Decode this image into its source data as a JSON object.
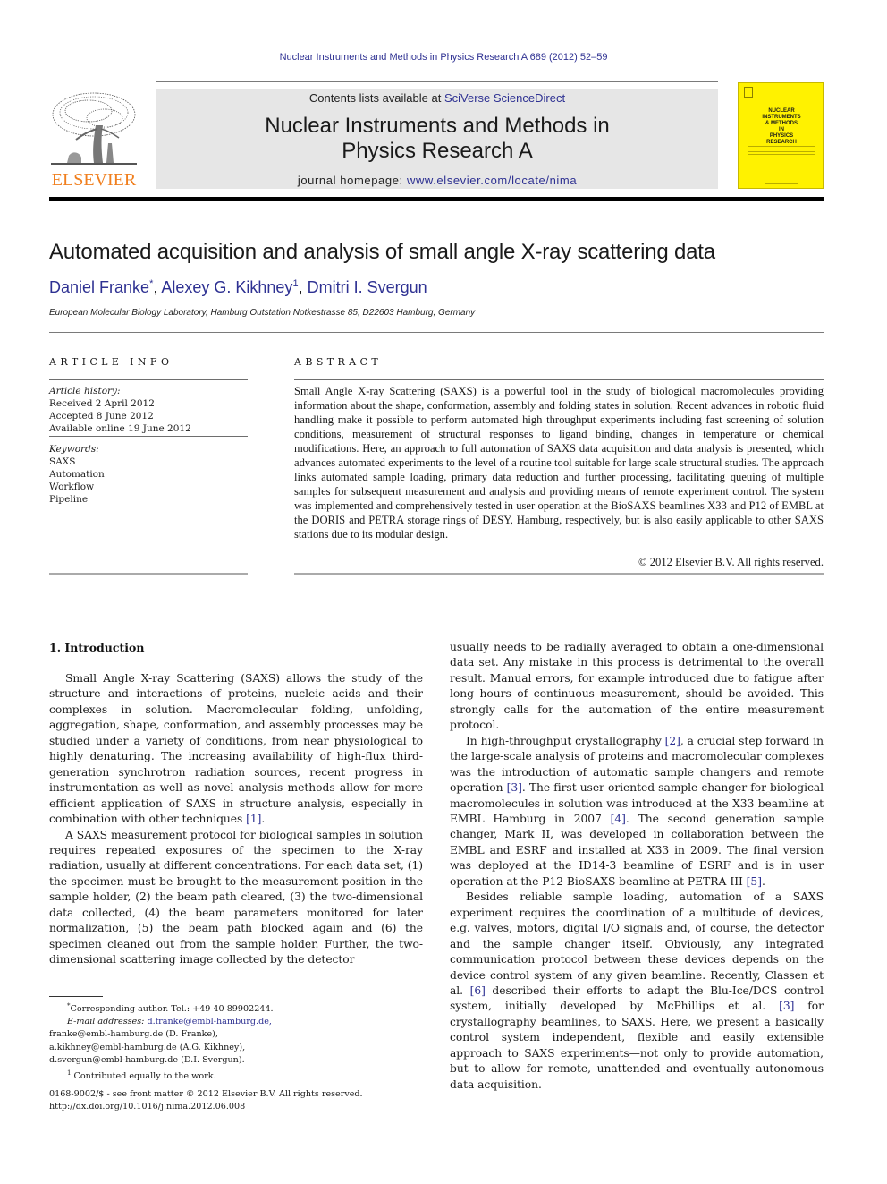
{
  "header": {
    "citation": "Nuclear Instruments and Methods in Physics Research A 689 (2012) 52–59",
    "contents_prefix": "Contents lists available at ",
    "contents_link": "SciVerse ScienceDirect",
    "journal_title_line1": "Nuclear Instruments and Methods in",
    "journal_title_line2": "Physics Research A",
    "homepage_prefix": "journal homepage: ",
    "homepage_link": "www.elsevier.com/locate/nima",
    "publisher_logo_text": "ELSEVIER",
    "publisher_logo_icon": "tree-icon",
    "cover_title": "NUCLEAR\nINSTRUMENTS\n& METHODS\nIN\nPHYSICS\nRESEARCH",
    "colors": {
      "link": "#2e3192",
      "elsevier_orange": "#f07f1e",
      "cover_yellow": "#fff200",
      "masthead_gray": "#e6e6e6"
    }
  },
  "article": {
    "title": "Automated acquisition and analysis of small angle X-ray scattering data",
    "authors": [
      {
        "name": "Daniel Franke",
        "mark": "*"
      },
      {
        "name": "Alexey G. Kikhney",
        "mark": "1"
      },
      {
        "name": "Dmitri I. Svergun",
        "mark": ""
      }
    ],
    "author_separator": ", ",
    "affiliation": "European Molecular Biology Laboratory, Hamburg Outstation Notkestrasse 85, D22603 Hamburg, Germany"
  },
  "article_info": {
    "heading": "ARTICLE INFO",
    "history_label": "Article history:",
    "history": [
      "Received 2 April 2012",
      "Accepted 8 June 2012",
      "Available online 19 June 2012"
    ],
    "keywords_label": "Keywords:",
    "keywords": [
      "SAXS",
      "Automation",
      "Workflow",
      "Pipeline"
    ]
  },
  "abstract": {
    "heading": "ABSTRACT",
    "text": "Small Angle X-ray Scattering (SAXS) is a powerful tool in the study of biological macromolecules providing information about the shape, conformation, assembly and folding states in solution. Recent advances in robotic fluid handling make it possible to perform automated high throughput experiments including fast screening of solution conditions, measurement of structural responses to ligand binding, changes in temperature or chemical modifications. Here, an approach to full automation of SAXS data acquisition and data analysis is presented, which advances automated experiments to the level of a routine tool suitable for large scale structural studies. The approach links automated sample loading, primary data reduction and further processing, facilitating queuing of multiple samples for subsequent measurement and analysis and providing means of remote experiment control. The system was implemented and comprehensively tested in user operation at the BioSAXS beamlines X33 and P12 of EMBL at the DORIS and PETRA storage rings of DESY, Hamburg, respectively, but is also easily applicable to other SAXS stations due to its modular design.",
    "copyright": "© 2012 Elsevier B.V. All rights reserved."
  },
  "introduction": {
    "heading": "1.  Introduction",
    "paragraphs": [
      {
        "parts": [
          {
            "t": "Small Angle X-ray Scattering (SAXS) allows the study of the structure and interactions of proteins, nucleic acids and their complexes in solution. Macromolecular folding, unfolding, aggregation, shape, conformation, and assembly processes may be studied under a variety of conditions, from near physiological to highly denaturing. The increasing availability of high-flux third-generation synchrotron radiation sources, recent progress in instrumentation as well as novel analysis methods allow for more efficient application of SAXS in structure analysis, especially in combination with other techniques "
          },
          {
            "ref": "[1]"
          },
          {
            "t": "."
          }
        ]
      },
      {
        "parts": [
          {
            "t": "A SAXS measurement protocol for biological samples in solution requires repeated exposures of the specimen to the X-ray radiation, usually at different concentrations. For each data set, (1) the specimen must be brought to the measurement position in the sample holder, (2) the beam path cleared, (3) the two-dimensional data collected, (4) the beam parameters monitored for later normalization, (5) the beam path blocked again and (6) the specimen cleaned out from the sample holder. Further, the two-dimensional scattering image collected by the detector"
          }
        ]
      }
    ],
    "right_paragraphs": [
      {
        "noindent": true,
        "parts": [
          {
            "t": "usually needs to be radially averaged to obtain a one-dimensional data set. Any mistake in this process is detrimental to the overall result. Manual errors, for example introduced due to fatigue after long hours of continuous measurement, should be avoided. This strongly calls for the automation of the entire measurement protocol."
          }
        ]
      },
      {
        "parts": [
          {
            "t": "In high-throughput crystallography "
          },
          {
            "ref": "[2]"
          },
          {
            "t": ", a crucial step forward in the large-scale analysis of proteins and macromolecular complexes was the introduction of automatic sample changers and remote operation "
          },
          {
            "ref": "[3]"
          },
          {
            "t": ". The first user-oriented sample changer for biological macromolecules in solution was introduced at the X33 beamline at EMBL Hamburg in 2007 "
          },
          {
            "ref": "[4]"
          },
          {
            "t": ". The second generation sample changer, Mark II, was developed in collaboration between the EMBL and ESRF and installed at X33 in 2009. The final version was deployed at the ID14-3 beamline of ESRF and is in user operation at the P12 BioSAXS beamline at PETRA-III "
          },
          {
            "ref": "[5]"
          },
          {
            "t": "."
          }
        ]
      },
      {
        "parts": [
          {
            "t": "Besides reliable sample loading, automation of a SAXS experiment requires the coordination of a multitude of devices, e.g. valves, motors, digital I/O signals and, of course, the detector and the sample changer itself. Obviously, any integrated communication protocol between these devices depends on the device control system of any given beamline. Recently, Classen et al. "
          },
          {
            "ref": "[6]"
          },
          {
            "t": " described their efforts to adapt the Blu-Ice/DCS control system, initially developed by McPhillips et al. "
          },
          {
            "ref": "[3]"
          },
          {
            "t": " for crystallography beamlines, to SAXS. Here, we present a basically control system independent, flexible and easily extensible approach to SAXS experiments—not only to provide automation, but to allow for remote, unattended and eventually autonomous data acquisition."
          }
        ]
      }
    ]
  },
  "footnotes": {
    "corresponding_mark": "*",
    "corresponding": "Corresponding author. Tel.: +49 40 89902244.",
    "email_label": "E-mail addresses:",
    "email_first": "d.franke@embl-hamburg.de,",
    "email_lines": [
      "franke@embl-hamburg.de (D. Franke),",
      "a.kikhney@embl-hamburg.de (A.G. Kikhney),",
      "d.svergun@embl-hamburg.de (D.I. Svergun)."
    ],
    "equal_mark": "1",
    "equal": "Contributed equally to the work."
  },
  "front_matter": {
    "issn": "0168-9002/$ - see front matter © 2012 Elsevier B.V. All rights reserved.",
    "doi": "http://dx.doi.org/10.1016/j.nima.2012.06.008"
  }
}
